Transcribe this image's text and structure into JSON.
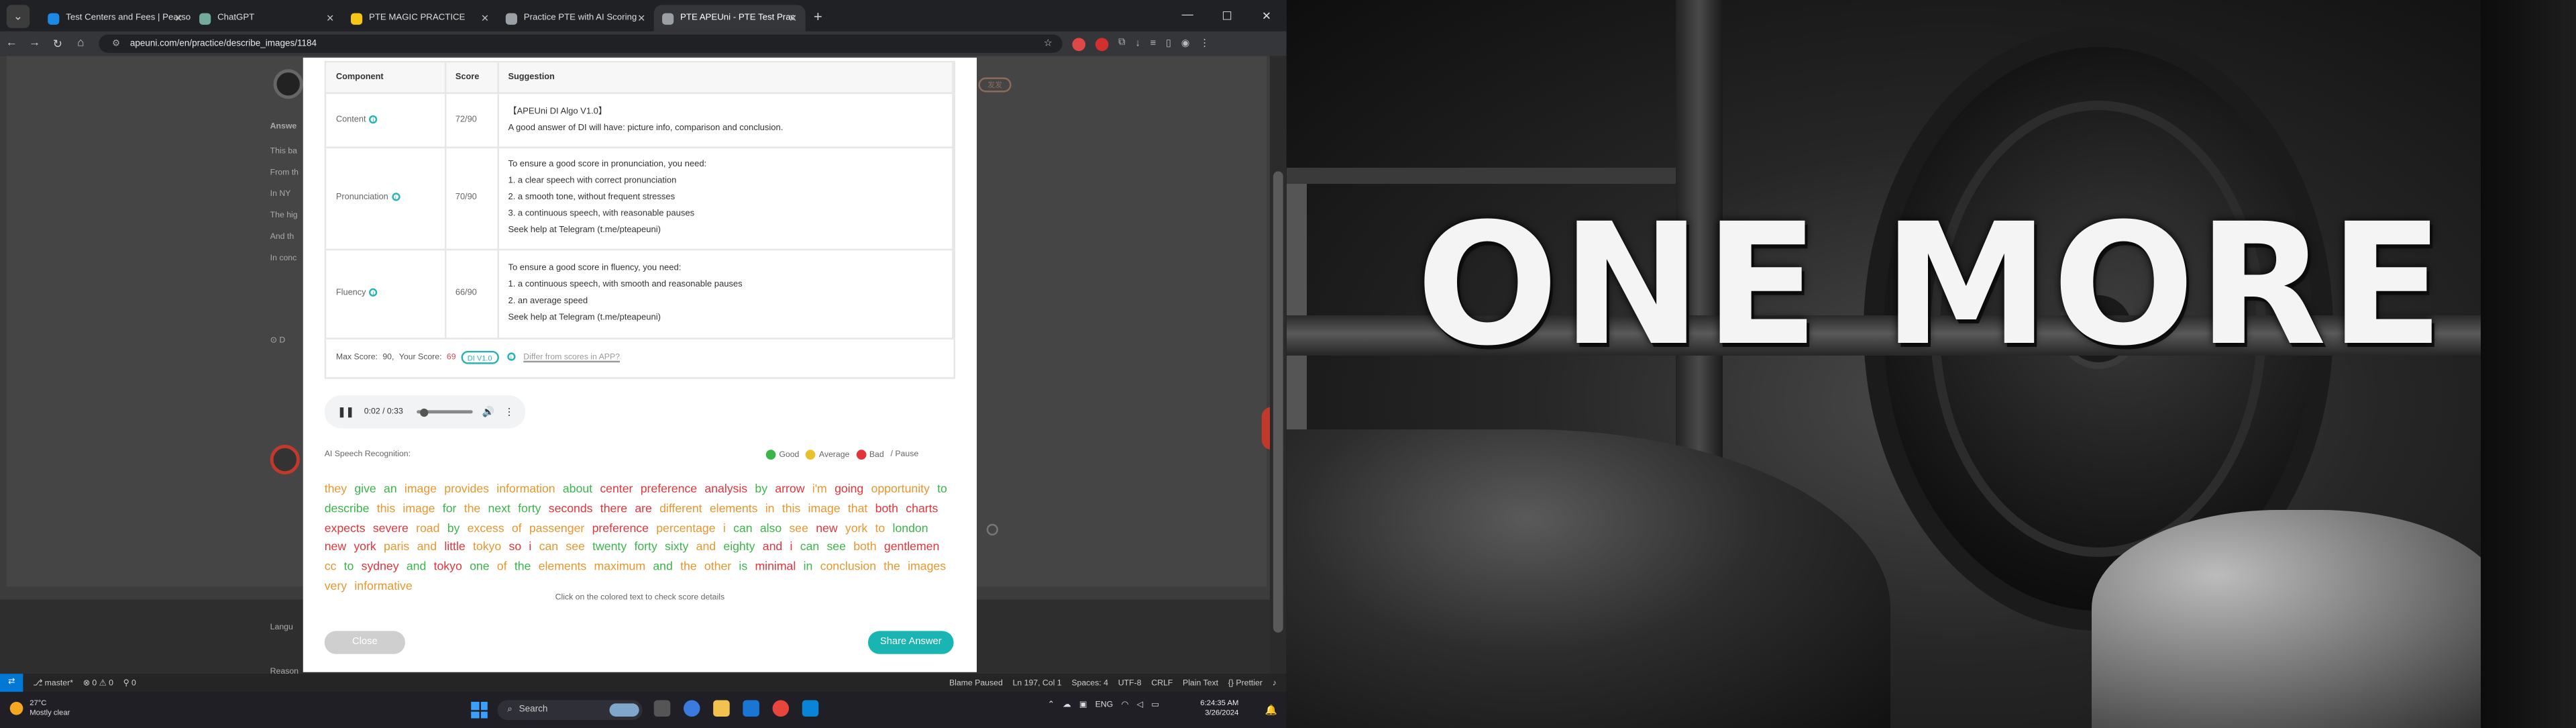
{
  "browser": {
    "tabs": [
      {
        "label": "Test Centers and Fees | Pearso",
        "favicon_color": "#1e88e5",
        "active": false
      },
      {
        "label": "ChatGPT",
        "favicon_color": "#74aa9c",
        "active": false
      },
      {
        "label": "PTE MAGIC PRACTICE",
        "favicon_color": "#f5c518",
        "active": false
      },
      {
        "label": "Practice PTE with AI Scoring",
        "favicon_color": "#9aa0a6",
        "active": false
      },
      {
        "label": "PTE APEUni - PTE Test Prac",
        "favicon_color": "#9aa0a6",
        "active": true
      }
    ],
    "url": "apeuni.com/en/practice/describe_images/1184"
  },
  "page": {
    "bg_texts": [
      "Answe",
      "This ba",
      "From th",
      "In NY",
      "The hig",
      "And th",
      "In conc"
    ],
    "badge_text": "发发",
    "footer_texts": [
      "Langu",
      "Reason"
    ]
  },
  "modal": {
    "table": {
      "headers": [
        "Component",
        "Score",
        "Suggestion"
      ],
      "rows": [
        {
          "component": "Content",
          "score": "72/90",
          "lines": [
            "【APEUni DI Algo V1.0】",
            "A good answer of DI will have: picture info, comparison and conclusion."
          ]
        },
        {
          "component": "Pronunciation",
          "score": "70/90",
          "lines": [
            "To ensure a good score in pronunciation, you need:",
            "1. a clear speech with correct pronunciation",
            "2. a smooth tone, without frequent stresses",
            "3. a continuous speech, with reasonable pauses",
            "Seek help at Telegram (t.me/pteapeuni)"
          ]
        },
        {
          "component": "Fluency",
          "score": "66/90",
          "lines": [
            "To ensure a good score in fluency, you need:",
            "1. a continuous speech, with smooth and reasonable pauses",
            "2. an average speed",
            "Seek help at Telegram (t.me/pteapeuni)"
          ]
        }
      ],
      "footer": {
        "max_score_label": "Max Score:",
        "max_score": "90,",
        "your_score_label": "Your Score:",
        "your_score": "69",
        "algo": "DI V1.0",
        "differ_link": "Differ from scores in APP?"
      }
    },
    "audio": {
      "time": "0:02 / 0:33",
      "progress": 0.06
    },
    "asr_label": "AI Speech Recognition:",
    "legend": {
      "good": "Good",
      "average": "Average",
      "bad": "Bad",
      "pause": "/  Pause"
    },
    "colors": {
      "good": "#3bb54a",
      "average": "#e8962e",
      "bad": "#e2353a",
      "accent": "#18b5b3"
    },
    "transcript": [
      [
        "they",
        "a"
      ],
      [
        "give",
        "g"
      ],
      [
        "an",
        "g"
      ],
      [
        "image",
        "a"
      ],
      [
        "provides",
        "a"
      ],
      [
        "information",
        "a"
      ],
      [
        "about",
        "g"
      ],
      [
        "center",
        "b"
      ],
      [
        "preference",
        "b"
      ],
      [
        "analysis",
        "b"
      ],
      [
        "by",
        "g"
      ],
      [
        "arrow",
        "b"
      ],
      [
        "i'm",
        "a"
      ],
      [
        "going",
        "b"
      ],
      [
        "opportunity",
        "a"
      ],
      [
        "to",
        "g"
      ],
      [
        "describe",
        "g"
      ],
      [
        "this",
        "a"
      ],
      [
        "image",
        "a"
      ],
      [
        "for",
        "g"
      ],
      [
        "the",
        "a"
      ],
      [
        "next",
        "g"
      ],
      [
        "forty",
        "g"
      ],
      [
        "seconds",
        "b"
      ],
      [
        "there",
        "b"
      ],
      [
        "are",
        "b"
      ],
      [
        "different",
        "a"
      ],
      [
        "elements",
        "a"
      ],
      [
        "in",
        "a"
      ],
      [
        "this",
        "a"
      ],
      [
        "image",
        "a"
      ],
      [
        "that",
        "a"
      ],
      [
        "both",
        "b"
      ],
      [
        "charts",
        "b"
      ],
      [
        "expects",
        "b"
      ],
      [
        "severe",
        "b"
      ],
      [
        "road",
        "a"
      ],
      [
        "by",
        "g"
      ],
      [
        "excess",
        "a"
      ],
      [
        "of",
        "a"
      ],
      [
        "passenger",
        "a"
      ],
      [
        "preference",
        "b"
      ],
      [
        "percentage",
        "a"
      ],
      [
        "i",
        "a"
      ],
      [
        "can",
        "g"
      ],
      [
        "also",
        "g"
      ],
      [
        "see",
        "a"
      ],
      [
        "new",
        "b"
      ],
      [
        "york",
        "a"
      ],
      [
        "to",
        "a"
      ],
      [
        "london",
        "g"
      ],
      [
        "new",
        "b"
      ],
      [
        "york",
        "b"
      ],
      [
        "paris",
        "a"
      ],
      [
        "and",
        "a"
      ],
      [
        "little",
        "b"
      ],
      [
        "tokyo",
        "a"
      ],
      [
        "so",
        "b"
      ],
      [
        "i",
        "b"
      ],
      [
        "can",
        "a"
      ],
      [
        "see",
        "a"
      ],
      [
        "twenty",
        "g"
      ],
      [
        "forty",
        "g"
      ],
      [
        "sixty",
        "g"
      ],
      [
        "and",
        "a"
      ],
      [
        "eighty",
        "g"
      ],
      [
        "and",
        "b"
      ],
      [
        "i",
        "b"
      ],
      [
        "can",
        "g"
      ],
      [
        "see",
        "g"
      ],
      [
        "both",
        "a"
      ],
      [
        "gentlemen",
        "b"
      ],
      [
        "cc",
        "a"
      ],
      [
        "to",
        "g"
      ],
      [
        "sydney",
        "b"
      ],
      [
        "and",
        "g"
      ],
      [
        "tokyo",
        "b"
      ],
      [
        "one",
        "g"
      ],
      [
        "of",
        "a"
      ],
      [
        "the",
        "g"
      ],
      [
        "elements",
        "a"
      ],
      [
        "maximum",
        "a"
      ],
      [
        "and",
        "g"
      ],
      [
        "the",
        "a"
      ],
      [
        "other",
        "a"
      ],
      [
        "is",
        "g"
      ],
      [
        "minimal",
        "b"
      ],
      [
        "in",
        "g"
      ],
      [
        "conclusion",
        "a"
      ],
      [
        "the",
        "a"
      ],
      [
        "images",
        "a"
      ],
      [
        "very",
        "a"
      ],
      [
        "informative",
        "a"
      ]
    ],
    "hint": "Click on the colored text to check score details",
    "close_label": "Close",
    "share_label": "Share Answer"
  },
  "statusbar": {
    "branch": "master*",
    "problems": "⊗ 0 ⚠ 0",
    "ports": "⚲ 0",
    "right_items": [
      "Blame Paused",
      "Ln 197, Col 1",
      "Spaces: 4",
      "UTF-8",
      "CRLF",
      "Plain Text",
      "{} Prettier"
    ]
  },
  "taskbar": {
    "weather_temp": "27°C",
    "weather_desc": "Mostly clear",
    "search_placeholder": "Search",
    "lang": "ENG",
    "time": "6:24:35 AM",
    "date": "3/26/2024"
  },
  "poster": {
    "text": "ONE MORE"
  }
}
